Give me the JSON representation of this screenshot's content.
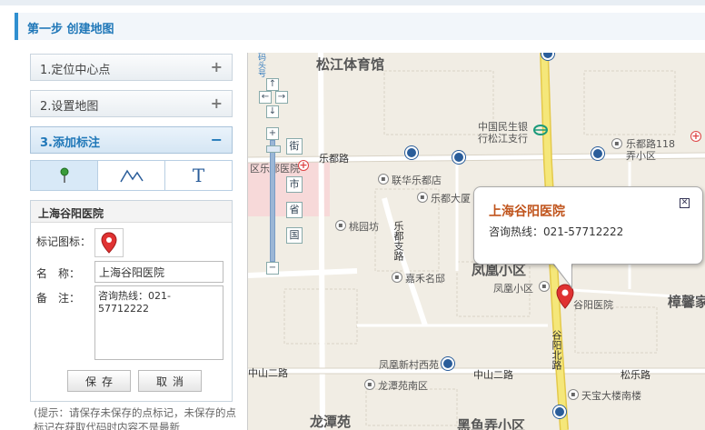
{
  "header": {
    "title": "第一步 创建地图"
  },
  "accordion": [
    {
      "label": "1.定位中心点",
      "symbol": "+"
    },
    {
      "label": "2.设置地图",
      "symbol": "+"
    },
    {
      "label": "3.添加标注",
      "symbol": "−"
    }
  ],
  "toolbar": {
    "tools": [
      {
        "icon": "marker-pin-icon"
      },
      {
        "icon": "polyline-icon"
      },
      {
        "icon": "text-icon",
        "label": "T"
      }
    ]
  },
  "form": {
    "title": "上海谷阳医院",
    "icon_label": "标记图标：",
    "name_label": "名　称：",
    "name_value": "上海谷阳医院",
    "note_label": "备　注：",
    "note_value": "咨询热线：021-57712222",
    "save_label": "保存",
    "cancel_label": "取消"
  },
  "tip": "(提示：请保存未保存的点标记，未保存的点标记在获取代码时内容不是最新",
  "map": {
    "zoom_modes": [
      "街",
      "市",
      "省",
      "国"
    ],
    "labels": {
      "district_top": "松江体育馆",
      "bank": "中国民生银\n行松江支行",
      "ledu_road_top": "乐都路",
      "ledu118": "乐都路118\n弄小区",
      "hospital_left": "区乐都医院",
      "lianhua": "联华乐都店",
      "ledu_building": "乐都大厦",
      "taoyuanfang": "桃园坊",
      "ledu_branch": "乐都支路",
      "jiahe": "嘉禾名邸",
      "fenghuang_big": "凤凰小区",
      "fenghuang": "凤凰小区",
      "guyang_poi": "谷阳医院",
      "zhangxin": "樟馨家",
      "guyang_road": "谷阳北路",
      "zhongshan_left": "中山二路",
      "zhongshan_mid": "中山二路",
      "songle": "松乐路",
      "fenghuang_xinxiyuan": "凤凰新村西苑",
      "longtan_south": "龙潭苑南区",
      "tianbao": "天宝大楼南楼",
      "longtan_big": "龙潭苑",
      "heiyu_big": "黑鱼弄小区",
      "gangs": "码头号"
    },
    "popup": {
      "title": "上海谷阳医院",
      "text": "咨询热线：021-57712222",
      "close": "✕"
    }
  },
  "colors": {
    "accent": "#1f77b8",
    "popup_title": "#c0541c",
    "marker": "#e03232",
    "main_road": "#f5e77a"
  }
}
